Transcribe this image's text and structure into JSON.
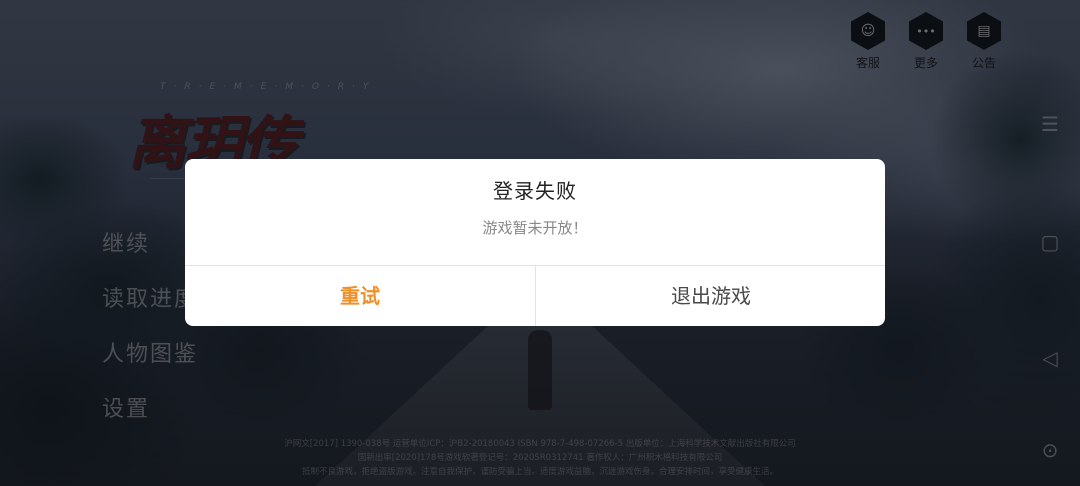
{
  "logo": {
    "title": "离玥传",
    "subtitle": "T·R·E·M·E·M·O·R·Y"
  },
  "menu": {
    "items": [
      "继续",
      "读取进度",
      "人物图鉴",
      "设置"
    ]
  },
  "top_buttons": [
    {
      "label": "客服",
      "icon": "customer-service-icon",
      "glyph": "☺"
    },
    {
      "label": "更多",
      "icon": "more-icon",
      "glyph": "•••"
    },
    {
      "label": "公告",
      "icon": "book-icon",
      "glyph": "▤"
    }
  ],
  "system_nav": {
    "menu_glyph": "☰",
    "square_glyph": "▢",
    "back_glyph": "◁",
    "circle_glyph": "⊙"
  },
  "dialog": {
    "title": "登录失败",
    "message": "游戏暂未开放！",
    "retry_label": "重试",
    "exit_label": "退出游戏"
  },
  "footer": {
    "line1": "沪网文[2017] 1390-038号 运营单位ICP：沪B2-20180043 ISBN 978-7-498-07266-5 出版单位：上海科学技术文献出版社有限公司",
    "line2": "国新出审[2020]178号游戏软著登记号：2020SR0312741 著作权人：广州积木格科技有限公司",
    "line3": "抵制不良游戏，拒绝盗版游戏。注意自我保护，谨防受骗上当。适度游戏益脑，沉迷游戏伤身。合理安排时间，享受健康生活。"
  },
  "colors": {
    "accent": "#f0902a",
    "dialog_bg": "#ffffff"
  }
}
